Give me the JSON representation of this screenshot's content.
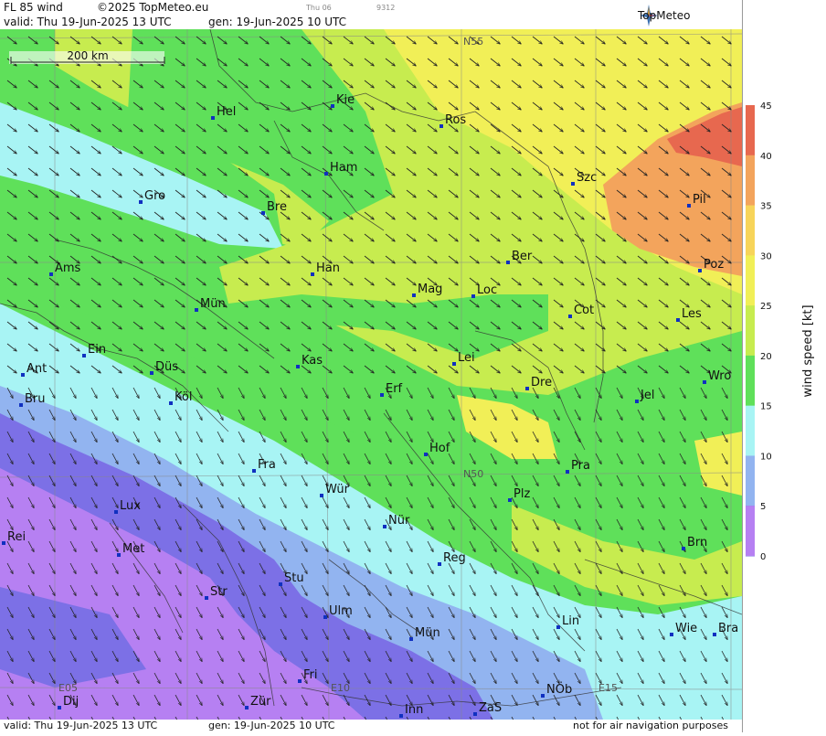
{
  "header": {
    "product": "FL 85 wind",
    "copyright": "©2025 TopMeteo.eu",
    "day_small": "Thu 06",
    "code_small": "9312",
    "valid": "valid:  Thu  19-Jun-2025  13 UTC",
    "gen": "gen: 19-Jun-2025 10 UTC",
    "logo": "TopMeteo"
  },
  "footer": {
    "valid": "valid:  Thu  19-Jun-2025  13 UTC",
    "gen": "gen: 19-Jun-2025 10 UTC",
    "disclaimer": "not for air navigation purposes"
  },
  "scale_bar": "200 km",
  "grid_labels": [
    "N55",
    "N50",
    "E05",
    "E10",
    "E15"
  ],
  "legend": {
    "title": "wind speed [kt]",
    "ticks": [
      "45",
      "40",
      "35",
      "30",
      "25",
      "20",
      "15",
      "10",
      "5",
      "0"
    ],
    "colors": [
      "#e7684f",
      "#f3a45c",
      "#f7d45a",
      "#f1ef57",
      "#c7ec4f",
      "#5fe05a",
      "#a8f4f4",
      "#92b4f0",
      "#7c70e6",
      "#b680f2"
    ]
  },
  "cities": [
    {
      "name": "Hel"
    },
    {
      "name": "Kie"
    },
    {
      "name": "Ros"
    },
    {
      "name": "Ham"
    },
    {
      "name": "Szc"
    },
    {
      "name": "Gro"
    },
    {
      "name": "Bre"
    },
    {
      "name": "Pil"
    },
    {
      "name": "Ams"
    },
    {
      "name": "Han"
    },
    {
      "name": "Ber"
    },
    {
      "name": "Poz"
    },
    {
      "name": "Mag"
    },
    {
      "name": "Loc"
    },
    {
      "name": "Mün"
    },
    {
      "name": "Cot"
    },
    {
      "name": "Les"
    },
    {
      "name": "Ein"
    },
    {
      "name": "Kas"
    },
    {
      "name": "Lei"
    },
    {
      "name": "Ant"
    },
    {
      "name": "Düs"
    },
    {
      "name": "Dre"
    },
    {
      "name": "Wro"
    },
    {
      "name": "Erf"
    },
    {
      "name": "Bru"
    },
    {
      "name": "Köl"
    },
    {
      "name": "Jel"
    },
    {
      "name": "Hof"
    },
    {
      "name": "Fra"
    },
    {
      "name": "Pra"
    },
    {
      "name": "Wür"
    },
    {
      "name": "Plz"
    },
    {
      "name": "Lux"
    },
    {
      "name": "Nür"
    },
    {
      "name": "Rei"
    },
    {
      "name": "Met"
    },
    {
      "name": "Reg"
    },
    {
      "name": "Brn"
    },
    {
      "name": "Stu"
    },
    {
      "name": "Str"
    },
    {
      "name": "Ulm"
    },
    {
      "name": "Lin"
    },
    {
      "name": "Wie"
    },
    {
      "name": "Bra"
    },
    {
      "name": "Mün"
    },
    {
      "name": "Fri"
    },
    {
      "name": "NÖb"
    },
    {
      "name": "Dij"
    },
    {
      "name": "Zür"
    },
    {
      "name": "Inn"
    },
    {
      "name": "ZaS"
    }
  ]
}
